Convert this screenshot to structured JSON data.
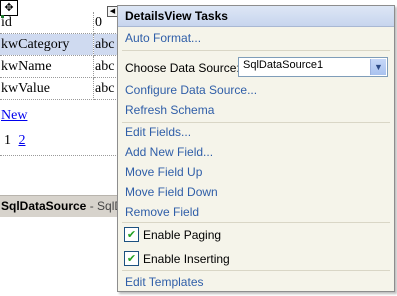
{
  "designer": {
    "rows": [
      {
        "name": "id",
        "value": "0"
      },
      {
        "name": "kwCategory",
        "value": "abc"
      },
      {
        "name": "kwName",
        "value": "abc"
      },
      {
        "name": "kwValue",
        "value": "abc"
      }
    ],
    "selected_row": "kwCategory",
    "new_link": "New",
    "pager": {
      "current": "1",
      "next": "2"
    },
    "datasource_label": "SqlDataSource",
    "datasource_rest": " - SqlDa",
    "move_glyph": "✥"
  },
  "panel": {
    "title": "DetailsView Tasks",
    "auto_format": "Auto Format...",
    "choose_source_label": "Choose Data Source:",
    "choose_source_value": "SqlDataSource1",
    "configure_source": "Configure Data Source...",
    "refresh_schema": "Refresh Schema",
    "edit_fields": "Edit Fields...",
    "add_new_field": "Add New Field...",
    "move_field_up": "Move Field Up",
    "move_field_down": "Move Field Down",
    "remove_field": "Remove Field",
    "enable_paging": "Enable Paging",
    "enable_paging_checked": true,
    "enable_inserting": "Enable Inserting",
    "enable_inserting_checked": true,
    "edit_templates": "Edit Templates",
    "check_mark": "✔",
    "dropdown_arrow": "▼",
    "smart_tag_arrow": "◀"
  },
  "colors": {
    "link": "#2f5ea8",
    "panel_bg": "#f5f4ea",
    "title_bg": "#c7d5ee",
    "selected_row": "#cfdaf0"
  }
}
